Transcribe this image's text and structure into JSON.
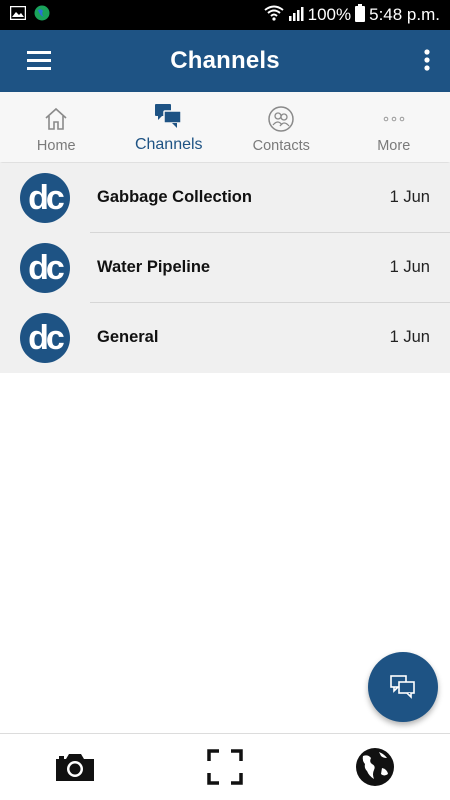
{
  "status_bar": {
    "battery": "100%",
    "time": "5:48 p.m.",
    "icons": [
      "image-icon",
      "globe-app-icon",
      "wifi-icon",
      "signal-icon",
      "battery-icon"
    ]
  },
  "app_bar": {
    "title": "Channels",
    "background": "#1e5384"
  },
  "tabs": [
    {
      "label": "Home",
      "icon": "home-icon",
      "active": false
    },
    {
      "label": "Channels",
      "icon": "chat-bubbles-icon",
      "active": true
    },
    {
      "label": "Contacts",
      "icon": "contacts-icon",
      "active": false
    },
    {
      "label": "More",
      "icon": "more-dots-icon",
      "active": false
    }
  ],
  "channels": [
    {
      "avatar": "dc",
      "name": "Gabbage Collection",
      "date": "1 Jun"
    },
    {
      "avatar": "dc",
      "name": "Water Pipeline",
      "date": "1 Jun"
    },
    {
      "avatar": "dc",
      "name": "General",
      "date": "1 Jun"
    }
  ],
  "fab": {
    "icon": "new-chat-icon"
  },
  "bottom_bar": [
    {
      "icon": "camera-icon"
    },
    {
      "icon": "scan-frame-icon"
    },
    {
      "icon": "globe-icon"
    }
  ],
  "colors": {
    "accent": "#1e5384",
    "row_bg": "#f0f0f0",
    "tab_bg": "#f7f7f7"
  }
}
